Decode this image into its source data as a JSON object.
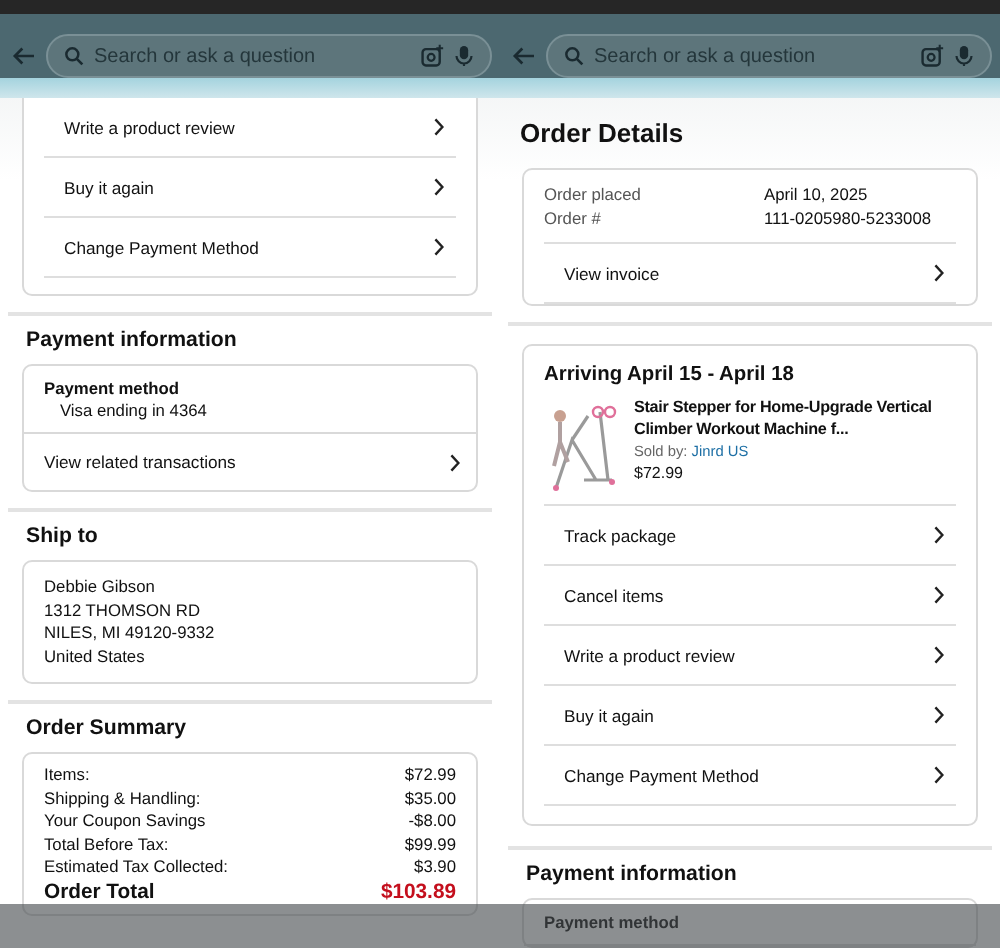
{
  "panels": [
    {
      "search": {
        "placeholder": "Search or ask a question"
      },
      "sections": [
        {
          "kind": "actions",
          "rows": [
            "Write a product review",
            "Buy it again",
            "Change Payment Method"
          ]
        },
        {
          "kind": "payment",
          "heading": "Payment information",
          "label": "Payment method",
          "value": "Visa ending in 4364",
          "link": "View related transactions"
        },
        {
          "kind": "address",
          "heading": "Ship to",
          "lines": [
            "Debbie Gibson",
            "1312 THOMSON RD",
            "NILES, MI 49120-9332",
            "United States"
          ]
        },
        {
          "kind": "summary",
          "heading": "Order Summary",
          "rows": [
            {
              "label": "Items:",
              "value": "$72.99"
            },
            {
              "label": "Shipping & Handling:",
              "value": "$35.00"
            },
            {
              "label": "Your Coupon Savings",
              "value": "-$8.00"
            },
            {
              "label": "Total Before Tax:",
              "value": "$99.99"
            },
            {
              "label": "Estimated Tax Collected:",
              "value": "$3.90"
            }
          ],
          "total": {
            "label": "Order Total",
            "value": "$103.89"
          }
        }
      ]
    },
    {
      "search": {
        "placeholder": "Search or ask a question"
      },
      "sections": [
        {
          "kind": "title",
          "text": "Order Details"
        },
        {
          "kind": "order_info",
          "rows": [
            {
              "label": "Order placed",
              "value": "April 10, 2025"
            },
            {
              "label": "Order #",
              "value": "111-0205980-5233008"
            }
          ],
          "link": "View invoice"
        },
        {
          "kind": "shipment",
          "heading": "Arriving April 15 - April 18",
          "product": {
            "title": "Stair Stepper for Home-Upgrade Vertical Climber Workout Machine f...",
            "seller_label": "Sold by:",
            "seller": "Jinrd US",
            "price": "$72.99"
          },
          "rows": [
            "Track package",
            "Cancel items",
            "Write a product review",
            "Buy it again",
            "Change Payment Method"
          ]
        },
        {
          "kind": "payment",
          "heading": "Payment information",
          "label": "Payment method"
        }
      ]
    }
  ]
}
